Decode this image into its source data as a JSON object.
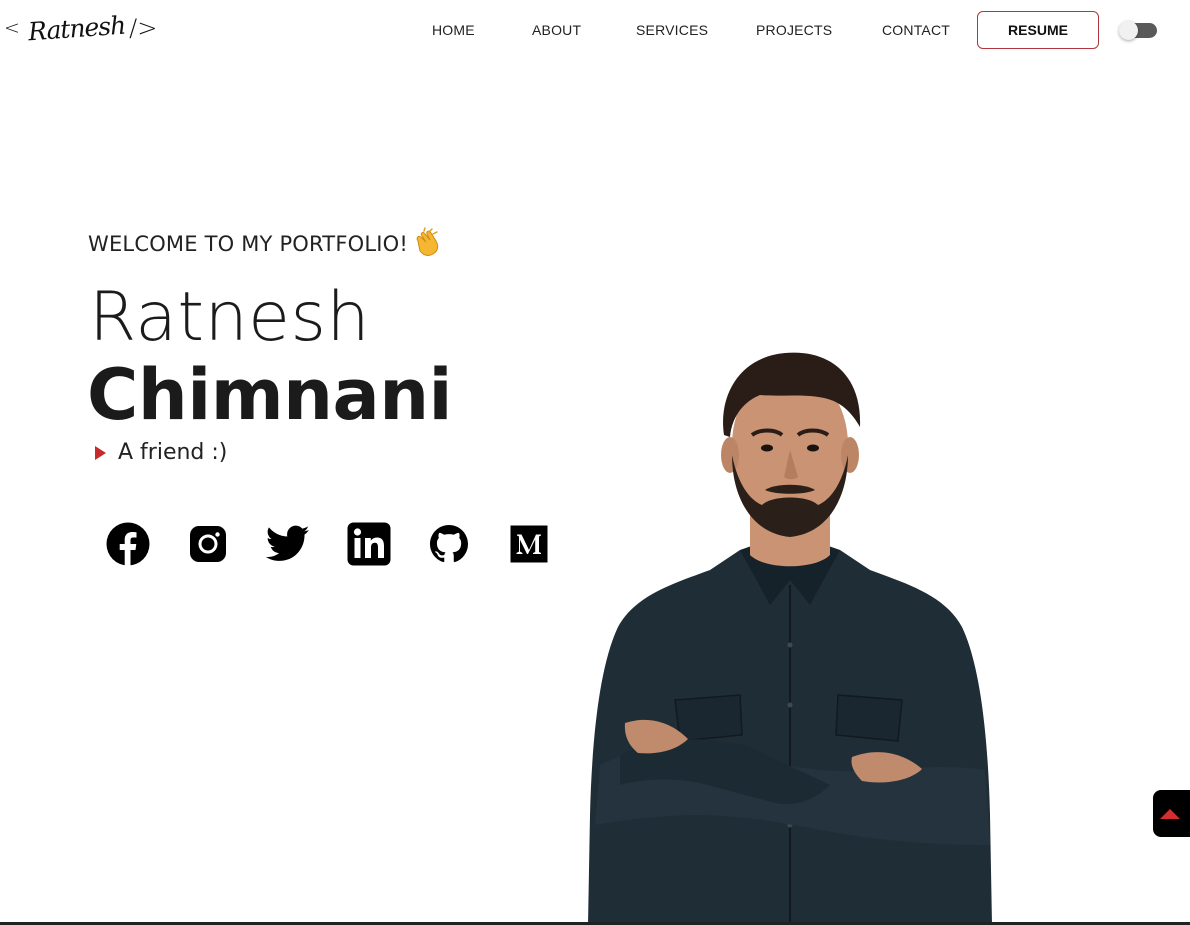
{
  "header": {
    "logo": {
      "open_bracket": "<",
      "signature": "Ratnesh",
      "close_bracket": "/>"
    },
    "nav": [
      {
        "label": "HOME"
      },
      {
        "label": "ABOUT"
      },
      {
        "label": "SERVICES"
      },
      {
        "label": "PROJECTS"
      },
      {
        "label": "CONTACT"
      }
    ],
    "resume_label": "RESUME",
    "theme_toggle": {
      "state": "off"
    }
  },
  "hero": {
    "welcome": "WELCOME TO MY PORTFOLIO!",
    "first_name": "Ratnesh",
    "last_name": "Chimnani",
    "tagline": "A friend :)",
    "socials": [
      {
        "icon": "facebook-icon"
      },
      {
        "icon": "instagram-icon"
      },
      {
        "icon": "twitter-icon"
      },
      {
        "icon": "linkedin-icon"
      },
      {
        "icon": "github-icon"
      },
      {
        "icon": "medium-icon"
      }
    ]
  },
  "colors": {
    "accent": "#b3353d",
    "arrow_red": "#c62b2b",
    "text": "#1b1b1b"
  }
}
